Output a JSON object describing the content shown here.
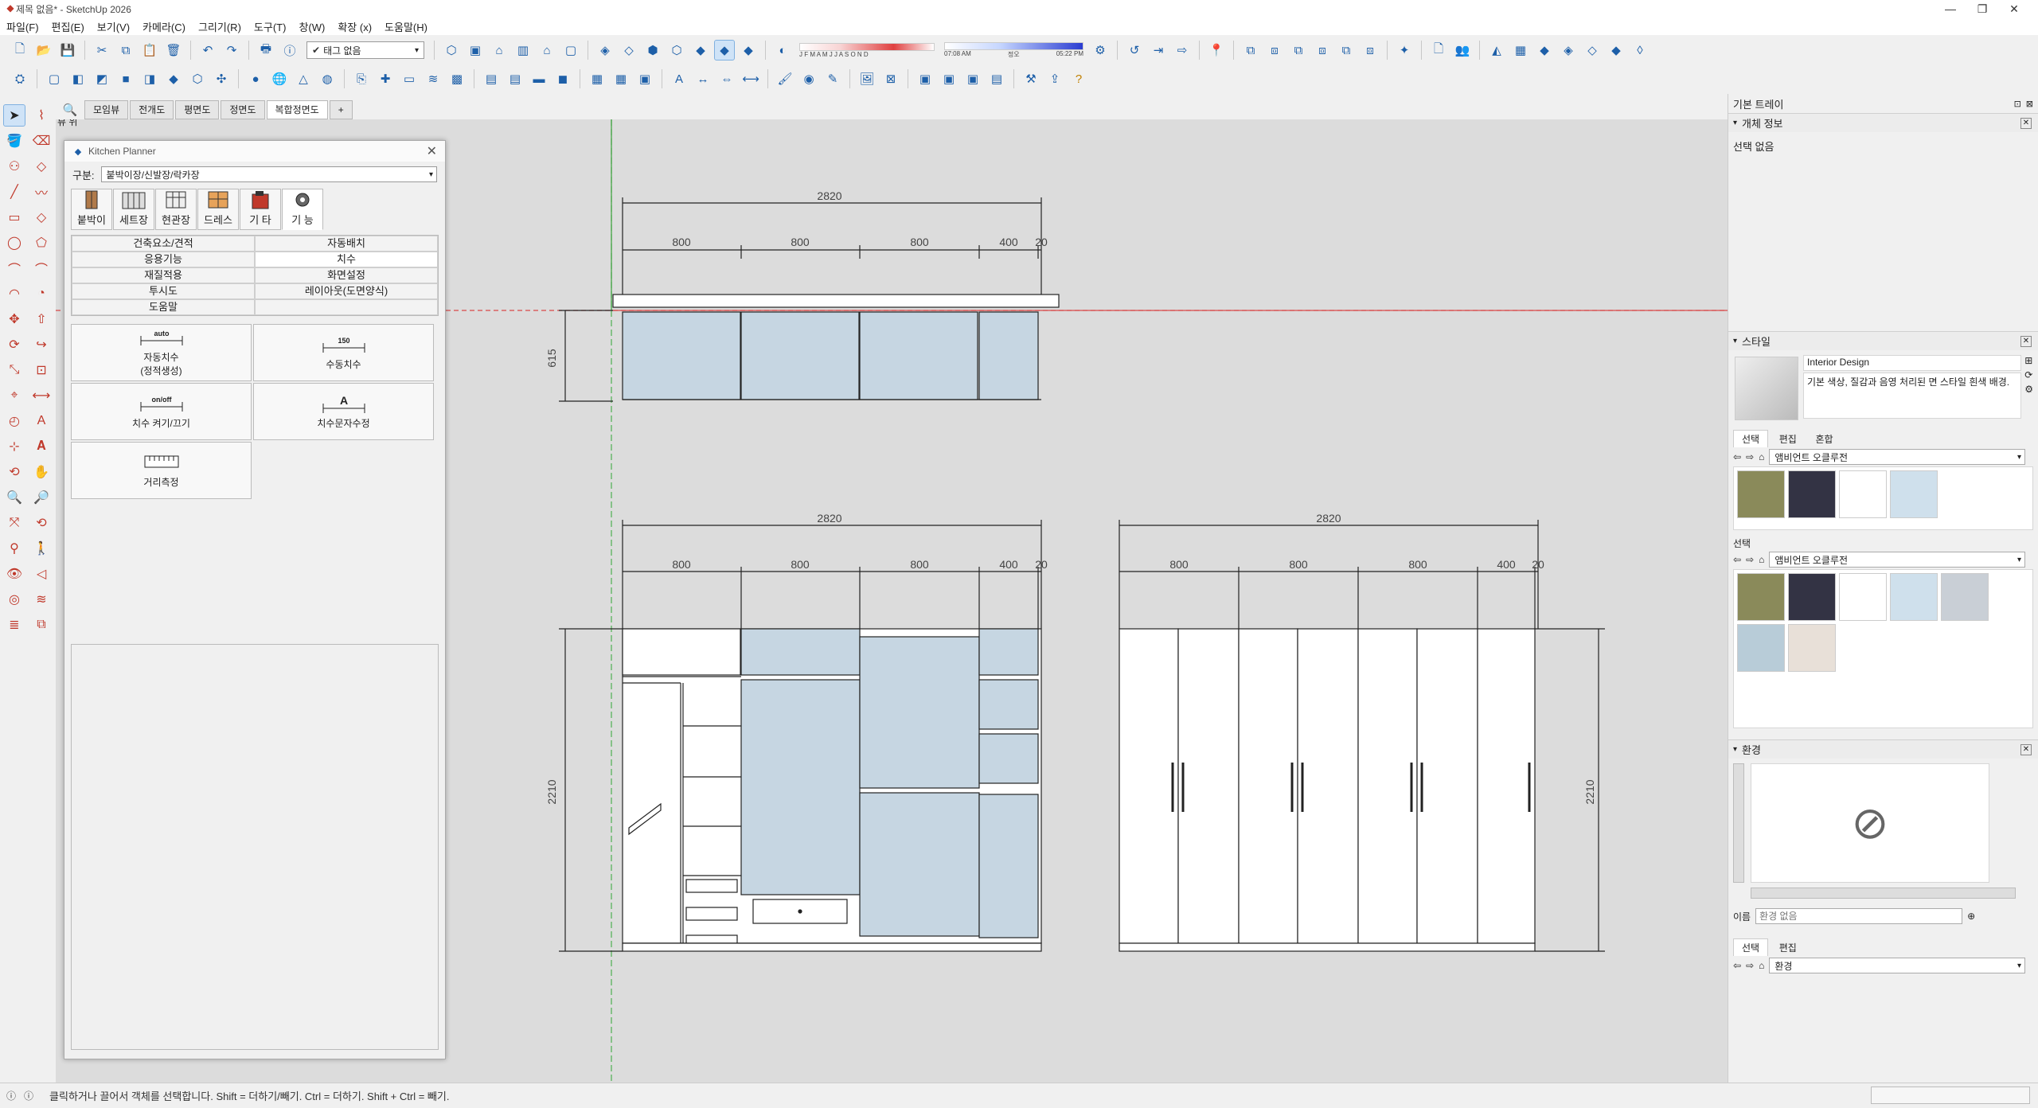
{
  "window": {
    "title": "제목 없음* - SketchUp 2026",
    "minimize": "—",
    "restore": "❐",
    "close": "✕"
  },
  "menu": [
    "파일(F)",
    "편집(E)",
    "보기(V)",
    "카메라(C)",
    "그리기(R)",
    "도구(T)",
    "창(W)",
    "확장 (x)",
    "도움말(H)"
  ],
  "toolbar": {
    "tag_select": "태그 없음",
    "months": "J F M A M J J A S O N D",
    "time_start": "07:08 AM",
    "time_mid": "정오",
    "time_end": "05:22 PM"
  },
  "scene_tabs": [
    "모임뷰",
    "전개도",
    "평면도",
    "정면도",
    "복합정면도",
    "+"
  ],
  "viewport_label": "뷰 위",
  "planner": {
    "title": "Kitchen Planner",
    "category_label": "구분:",
    "category_value": "붙박이장/신발장/락카장",
    "tabs": [
      "붙박이",
      "세트장",
      "현관장",
      "드레스",
      "기  타",
      "기  능"
    ],
    "menu": [
      "건축요소/견적",
      "자동배치",
      "응용기능",
      "치수",
      "재질적용",
      "화면설정",
      "투시도",
      "레이아웃(도면양식)",
      "도움말",
      ""
    ],
    "functions": [
      {
        "icon_text": "auto",
        "label": "자동치수\n(정적생성)"
      },
      {
        "icon_text": "150",
        "label": "수동치수"
      },
      {
        "icon_text": "on/off",
        "label": "치수 켜기/끄기"
      },
      {
        "icon_text": "A",
        "label": "치수문자수정"
      },
      {
        "icon_text": "",
        "label": "거리측정"
      }
    ]
  },
  "drawing": {
    "top_total": "2820",
    "top_segments": [
      "800",
      "800",
      "800",
      "400",
      "20"
    ],
    "top_height": "615",
    "left_total": "2820",
    "left_segments": [
      "800",
      "800",
      "800",
      "400",
      "20"
    ],
    "left_height": "2210",
    "right_total": "2820",
    "right_segments": [
      "800",
      "800",
      "800",
      "400",
      "20"
    ],
    "right_height": "2210"
  },
  "tray": {
    "title": "기본 트레이",
    "entity_info": {
      "header": "개체 정보",
      "value": "선택 없음"
    },
    "styles": {
      "header": "스타일",
      "style_name": "Interior Design",
      "style_desc": "기본 색상, 질감과 음영 처리된 면 스타일 흰색 배경.",
      "subtabs": [
        "선택",
        "편집",
        "혼합"
      ],
      "collection1": "앰비언트 오클루전",
      "select_label": "선택",
      "collection2": "앰비언트 오클루전"
    },
    "environment": {
      "header": "환경",
      "name_label": "이름",
      "name_placeholder": "환경 없음",
      "subtabs": [
        "선택",
        "편집"
      ],
      "collection": "환경"
    }
  },
  "status": {
    "text": "클릭하거나 끌어서 객체를 선택합니다. Shift = 더하기/빼기. Ctrl = 더하기. Shift + Ctrl = 빼기."
  }
}
